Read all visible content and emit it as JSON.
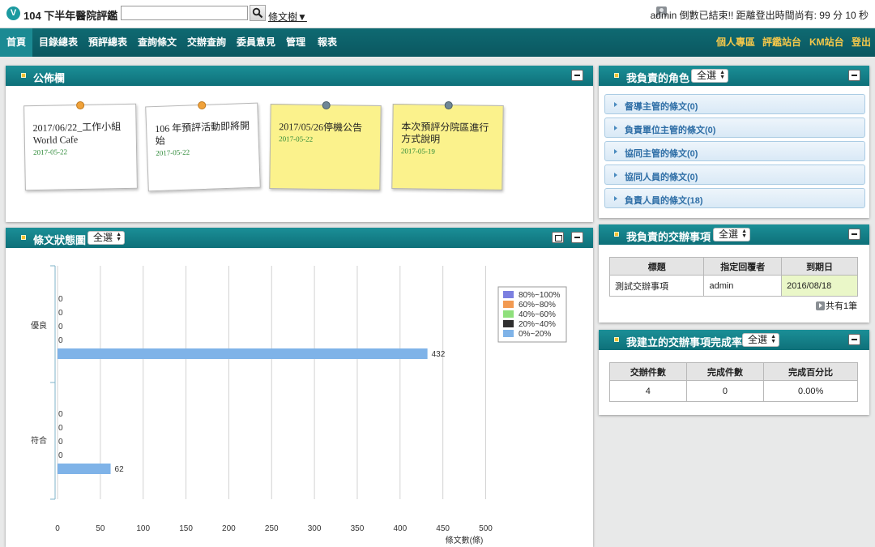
{
  "app": {
    "logo": "V",
    "title": "104 下半年醫院評鑑"
  },
  "search": {
    "value": "",
    "placeholder": "",
    "tree_link": "條文樹▼"
  },
  "user": {
    "text": "admin 倒數已結束!! 距離登出時間尚有: 99 分 10 秒"
  },
  "nav": {
    "left": [
      "首頁",
      "目錄總表",
      "預評總表",
      "查詢條文",
      "交辦查詢",
      "委員意見",
      "管理",
      "報表"
    ],
    "right": [
      "個人專區",
      "評鑑站台",
      "KM站台",
      "登出"
    ]
  },
  "bulletin": {
    "title": "公佈欄",
    "notes": [
      {
        "title": "2017/06/22_工作小組 World Cafe",
        "date": "2017-05-22",
        "color": "#ffffff",
        "pin": "#f0a23a"
      },
      {
        "title": "106 年預評活動即將開始",
        "date": "2017-05-22",
        "color": "#ffffff",
        "pin": "#f0a23a"
      },
      {
        "title": "2017/05/26停機公告",
        "date": "2017-05-22",
        "color": "#fbf28c",
        "pin": "#6f8797"
      },
      {
        "title": "本次預評分院區進行方式說明",
        "date": "2017-05-19",
        "color": "#fbf28c",
        "pin": "#6f8797"
      }
    ]
  },
  "status_chart_panel": {
    "title": "條文狀態圖",
    "select": "全選"
  },
  "chart_data": {
    "type": "bar",
    "orientation": "horizontal",
    "categories": [
      "優良",
      "符合"
    ],
    "series": [
      {
        "name": "80%~100%",
        "color": "#7b7fe0",
        "values": [
          0,
          0
        ]
      },
      {
        "name": "60%~80%",
        "color": "#f29a52",
        "values": [
          0,
          0
        ]
      },
      {
        "name": "40%~60%",
        "color": "#8fe07c",
        "values": [
          0,
          0
        ]
      },
      {
        "name": "20%~40%",
        "color": "#2f2f2f",
        "values": [
          0,
          0
        ]
      },
      {
        "name": "0%~20%",
        "color": "#7fb3e8",
        "values": [
          432,
          62
        ]
      }
    ],
    "xlabel": "條文數(條)",
    "xlim": [
      0,
      500
    ],
    "xticks": [
      0,
      50,
      100,
      150,
      200,
      250,
      300,
      350,
      400,
      450,
      500
    ],
    "grid": true,
    "legend": "top-right"
  },
  "roles": {
    "title": "我負責的角色",
    "select": "全選",
    "items": [
      "督導主管的條文(0)",
      "負責單位主管的條文(0)",
      "協同主管的條文(0)",
      "協同人員的條文(0)",
      "負責人員的條文(18)"
    ]
  },
  "tasks": {
    "title": "我負責的交辦事項",
    "select": "全選",
    "headers": [
      "標題",
      "指定回覆者",
      "到期日"
    ],
    "rows": [
      [
        "測試交辦事項",
        "admin",
        "2016/08/18"
      ]
    ],
    "total": "共有1筆"
  },
  "completion": {
    "title": "我建立的交辦事項完成率",
    "select": "全選",
    "headers": [
      "交辦件數",
      "完成件數",
      "完成百分比"
    ],
    "rows": [
      [
        "4",
        "0",
        "0.00%"
      ]
    ]
  }
}
